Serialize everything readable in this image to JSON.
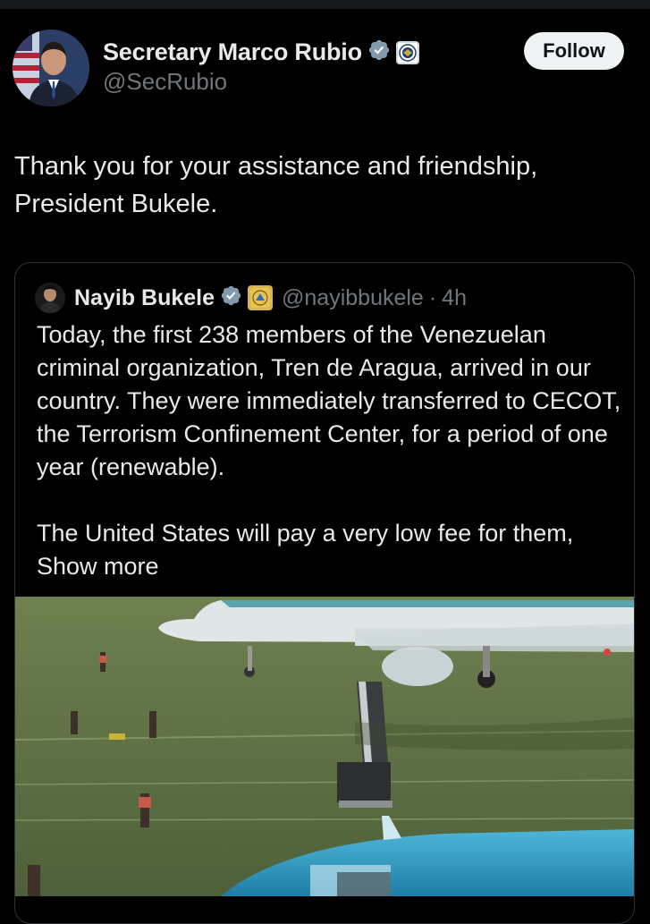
{
  "author": {
    "display_name": "Secretary Marco Rubio",
    "handle": "@SecRubio",
    "follow_label": "Follow"
  },
  "tweet": {
    "text": "Thank you for your assistance and friendship,\nPresident Bukele."
  },
  "quoted": {
    "display_name": "Nayib Bukele",
    "handle": "@nayibbukele",
    "separator": "·",
    "time": "4h",
    "body": "Today, the first 238 members of the Venezuelan criminal organization, Tren de Aragua, arrived in our country. They were immediately transferred to CECOT, the Terrorism Confinement Center, for a period of one year (renewable).\n\nThe United States will pay a very low fee for them, ",
    "show_more": "Show more"
  },
  "colors": {
    "background": "#000000",
    "verified": "#829aab",
    "text": "#e7e9ea",
    "muted": "#71767b"
  },
  "icons": {
    "verified": "verified-badge-icon",
    "org": "state-department-seal-icon",
    "el-salvador": "el-salvador-seal-icon"
  }
}
